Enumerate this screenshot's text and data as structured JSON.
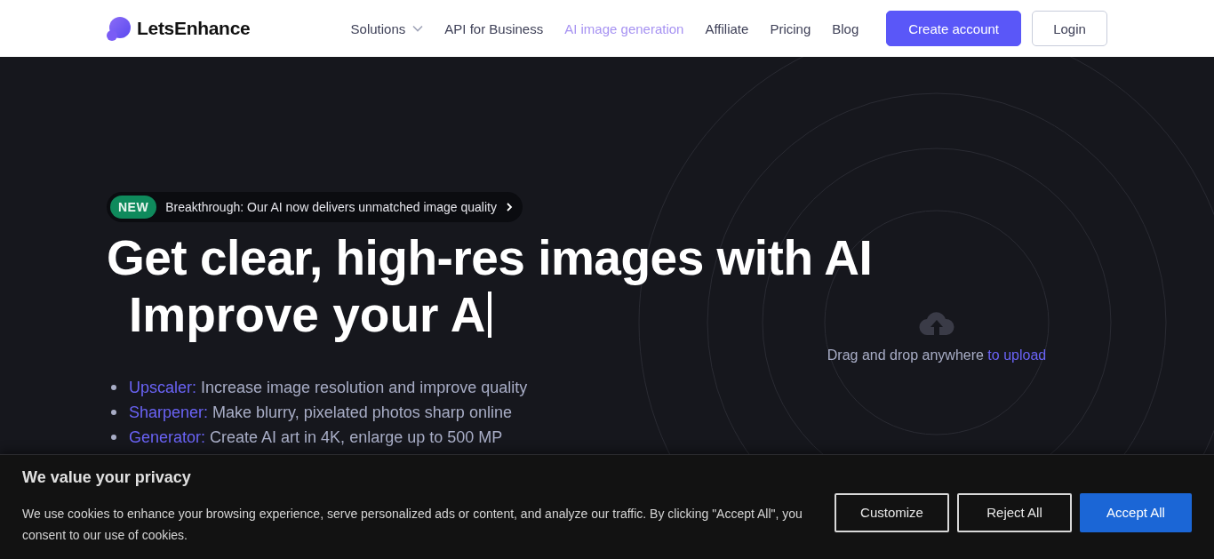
{
  "header": {
    "logo": "LetsEnhance",
    "nav": [
      {
        "label": "Solutions",
        "has_menu": true,
        "selected": false
      },
      {
        "label": "API for Business",
        "has_menu": false,
        "selected": false
      },
      {
        "label": "AI image generation",
        "has_menu": false,
        "selected": true
      },
      {
        "label": "Affiliate",
        "has_menu": false,
        "selected": false
      },
      {
        "label": "Pricing",
        "has_menu": false,
        "selected": false
      },
      {
        "label": "Blog",
        "has_menu": false,
        "selected": false
      }
    ],
    "buttons": [
      {
        "label": "Create account",
        "kind": "primary"
      },
      {
        "label": "Login",
        "kind": "outline"
      }
    ]
  },
  "hero": {
    "announcement": {
      "badge": "NEW",
      "text": "Breakthrough: Our AI now delivers unmatched image quality"
    },
    "headline": "Get clear, high-res images with AI",
    "typed_line": "Improve your A",
    "features": [
      {
        "name": "Upscaler:",
        "description": "Increase image resolution and improve quality"
      },
      {
        "name": "Sharpener:",
        "description": "Make blurry, pixelated photos sharp online"
      },
      {
        "name": "Generator:",
        "description": "Create AI art in 4K, enlarge up to 500 MP"
      }
    ],
    "upload": {
      "text": "Drag and drop anywhere",
      "link": "to upload"
    }
  },
  "cookie_banner": {
    "title": "We value your privacy",
    "text": "We use cookies to enhance your browsing experience, serve personalized ads or content, and analyze our traffic. By clicking \"Accept All\", you consent to our use of cookies.",
    "buttons": [
      {
        "label": "Customize",
        "kind": "outline"
      },
      {
        "label": "Reject All",
        "kind": "outline"
      },
      {
        "label": "Accept All",
        "kind": "primary"
      }
    ]
  }
}
